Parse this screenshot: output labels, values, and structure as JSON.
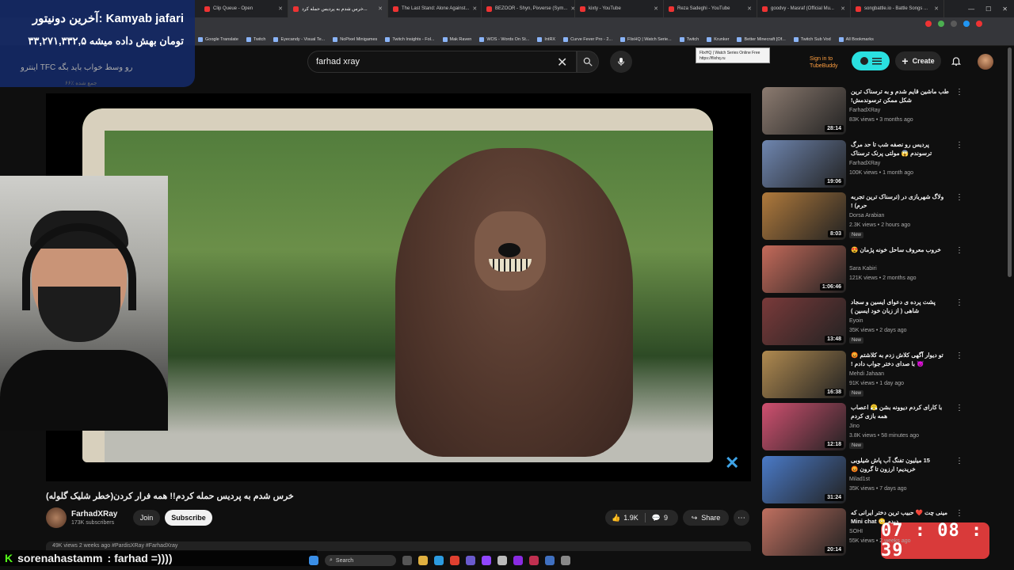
{
  "colors": {
    "accent_red": "#ff0000",
    "timer_bg": "#d93a3a",
    "chat_badge": "#53fc18",
    "hd_logo": "#3fa3e6"
  },
  "tabs": [
    {
      "label": "Clip Queue - Open"
    },
    {
      "label": "خرس شدم به پردیس حمله کرد...",
      "active": true
    },
    {
      "label": "The Last Stand: Alone Against..."
    },
    {
      "label": "BEZOOR - Shyn, Pixverse (Sym..."
    },
    {
      "label": "kixty - YouTube"
    },
    {
      "label": "Reza Sadeghi - YouTube"
    },
    {
      "label": "goodvy - Masraf (Official Mu..."
    },
    {
      "label": "songbattle.io - Battle Songs ..."
    }
  ],
  "bookmarks": [
    "Google Translate",
    "Twitch",
    "Eyecandy - Visual Te...",
    "NoPixel Minigames",
    "Twitch Insights - Fol...",
    "Mak Raven",
    "WOS - Words On St...",
    "IntRX",
    "Curve Fever Pro - 2...",
    "FlixHQ | Watch Serie...",
    "Twitch",
    "Krunker",
    "Better Minecraft [Of...",
    "Twitch Sub Vod",
    "All Bookmarks"
  ],
  "tooltip": {
    "line1": "FlixHQ | Watch Series Online Free",
    "line2": "https://flixhq.ru"
  },
  "search": {
    "value": "farhad xray"
  },
  "header": {
    "signin": "Sign in to",
    "tubebuddy": "TubeBuddy",
    "create_label": "Create"
  },
  "donor": {
    "line1": "آخرین دونیتور: Kamyab jafari",
    "line2": "۳۳,۲۷۱,۳۳۲,۵ تومان بهش داده میشه",
    "sub1": "اینترو TFC رو وسط خواب باید بگه",
    "sub2": "۶۶٪ جمع شده"
  },
  "video": {
    "title": "خرس شدم به پردیس حمله کردم!! همه فرار کردن(خطر شلیک گلوله)",
    "channel": "FarhadXRay",
    "subs": "173K subscribers",
    "join_label": "Join",
    "subscribe_label": "Subscribe",
    "likes": "1.9K",
    "comments": "9",
    "share_label": "Share",
    "desc_peek": "49K views  2 weeks ago  #PardisXRay #FarhadXray"
  },
  "chat": {
    "user": "sorenahastamm",
    "message": ": farhad =))))"
  },
  "taskbar": {
    "search_label": "Search"
  },
  "timer": "07 : 08 : 39",
  "recommendations": [
    {
      "title": "طب ماشین قایم شدم و به ترسناک ترین شکل ممکن ترسوندمش!",
      "channel": "FarhadXRay",
      "meta": "83K views • 3 months ago",
      "duration": "28:14",
      "new": false,
      "thumb": "#8c7b70"
    },
    {
      "title": "پردیس رو نصفه شب تا حد مرگ ترسوندم 😱 مولتی پرنک ترسناک",
      "channel": "FarhadXRay",
      "meta": "100K views • 1 month ago",
      "duration": "19:06",
      "new": false,
      "thumb": "#6f86b0"
    },
    {
      "title": "ولاگ شهربازی در (ترسناک ترین تجربه حرم) !",
      "channel": "Dorsa Arabian",
      "meta": "2.3K views • 2 hours ago",
      "duration": "8:03",
      "new": true,
      "thumb": "#b07a3c"
    },
    {
      "title": "خروب معروف ساحل خونه پژمان 😍",
      "channel": "Sara Kabiri",
      "meta": "121K views • 2 months ago",
      "duration": "1:06:46",
      "new": false,
      "thumb": "#c46a5a"
    },
    {
      "title": "پشت پرده ی دعوای ایسین و سجاد شاهی ( از زبان خود ایسین )",
      "channel": "Eyoin",
      "meta": "35K views • 2 days ago",
      "duration": "13:48",
      "new": true,
      "thumb": "#7a3a3a"
    },
    {
      "title": "تو دیوار آگهی کلاش زدم به کلاشتم 😡 😈 با صدای دختر جواب دادم !",
      "channel": "Mehdi Jahaan",
      "meta": "91K views • 1 day ago",
      "duration": "16:38",
      "new": true,
      "thumb": "#b08a50"
    },
    {
      "title": "با کارای کردم دیوونه بشن 😤 اعصاب همه بازی کردم",
      "channel": "Jino",
      "meta": "3.8K views • 58 minutes ago",
      "duration": "12:18",
      "new": true,
      "thumb": "#d05070"
    },
    {
      "title": "15 میلیون تفنگ آب پاش شیلوبی خریدیم! ارزون تا گرون 😡",
      "channel": "Milad1st",
      "meta": "35K views • 7 days ago",
      "duration": "31:24",
      "new": false,
      "thumb": "#4a7ac8"
    },
    {
      "title": "مینی چت ❤️ حبیب ترین دختر ایرانی که دیدم 😳 Mini chat",
      "channel": "SOHI",
      "meta": "55K views • 2 weeks ago",
      "duration": "20:14",
      "new": false,
      "thumb": "#c07060"
    }
  ]
}
